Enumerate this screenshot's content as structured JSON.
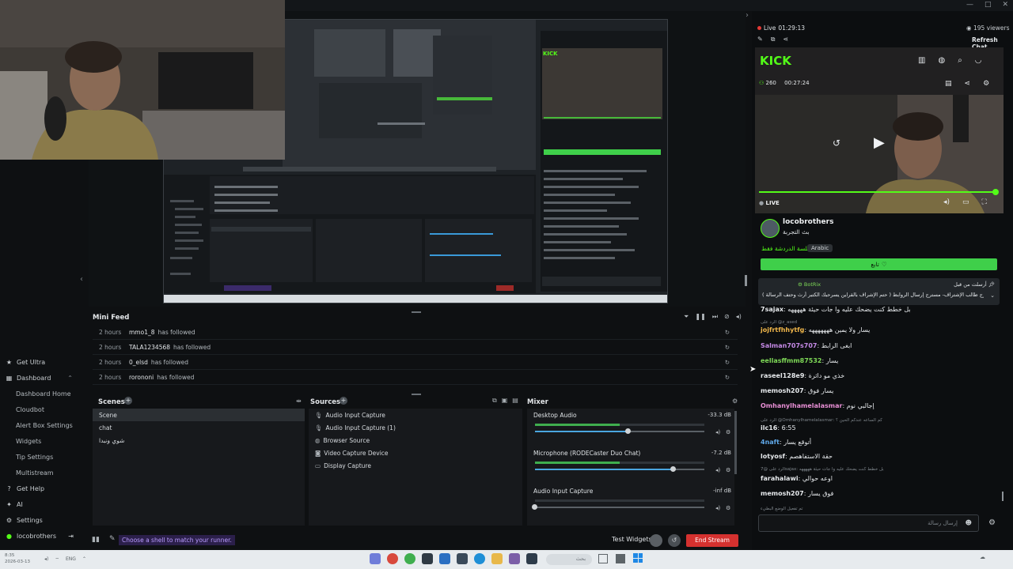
{
  "window": {
    "controls": [
      "—",
      "□",
      "✕"
    ]
  },
  "stream": {
    "live_label": "Live",
    "live_time": "01:29:13",
    "viewers": "195 viewers",
    "refresh_chat": "Refresh Chat"
  },
  "kick": {
    "logo": "KICK",
    "viewer_count": "260",
    "elapsed": "00:27:24",
    "live_badge": "LIVE",
    "channel_name": "locobrothers",
    "channel_subtitle": "بث التجربة",
    "category": "مسلسة الدردشة فقط",
    "language_tag": "Arabic",
    "follow_label": "تابع",
    "pinned_bot": "BotRix",
    "pinned_title": "أرسلت من قبل",
    "pinned_text": "لغيرين- مسترج طالب الإشتراف- مسترج إرسال الروابط ( حتم الإشراف بالقراين يسرحبك الكتبر أرث وحتف الرسالة )",
    "chat_placeholder": "إرسال رسالة"
  },
  "chat": [
    {
      "user": "7sajax",
      "color": "#e6e9ec",
      "text": ": بل خطط كنت يضحك عليه وا جات حيئة هههههه"
    },
    {
      "user": "jojfrtfhhytfg",
      "color": "#f0b64a",
      "text": ": يسار ولا يمين هههههههه"
    },
    {
      "user": "Salman707s707",
      "color": "#c58ae6",
      "text": ": ابغى الرابط"
    },
    {
      "user": "eellasffmm87532",
      "color": "#7ed957",
      "text": ": يسار"
    },
    {
      "user": "raseel128e9",
      "color": "#e6e9ec",
      "text": ": خذي مو داثرة"
    },
    {
      "user": "memosh207",
      "color": "#e6e9ec",
      "text": ": يسار فوق"
    },
    {
      "user": "Omhanylhamelalasmar",
      "color": "#e88fd5",
      "text": ": إجالبي نوم"
    },
    {
      "user": "ilc16",
      "color": "#e6e9ec",
      "text": ": 6:55"
    },
    {
      "user": "4naft",
      "color": "#5fa8e8",
      "text": ": أتوقع يسار"
    },
    {
      "user": "lotyosf",
      "color": "#e6e9ec",
      "text": ": حقة الاستفاهصم"
    },
    {
      "user": "farahalawi",
      "color": "#e6e9ec",
      "text": ": اوعه حوالي"
    },
    {
      "user": "memosh207",
      "color": "#e6e9ec",
      "text": ": فوق يسار"
    }
  ],
  "chat_replies": [
    "الرد على @Omhanylhamelalasmar: كم الساعه عندكم الحين ؟",
    "الرد على @7sajax: بل خطط كنت يضحك عليه وا جات حيئة هههههه",
    "الرد على @z_ased"
  ],
  "chat_typing": "تم تفعيل الوضع البطيء",
  "nav": {
    "items": [
      {
        "label": "Get Ultra",
        "icon": "★",
        "sub": false
      },
      {
        "label": "Dashboard",
        "icon": "▦",
        "sub": false
      },
      {
        "label": "Dashboard Home",
        "sub": true
      },
      {
        "label": "Cloudbot",
        "sub": true
      },
      {
        "label": "Alert Box Settings",
        "sub": true
      },
      {
        "label": "Widgets",
        "sub": true
      },
      {
        "label": "Tip Settings",
        "sub": true
      },
      {
        "label": "Multistream",
        "sub": true
      },
      {
        "label": "Get Help",
        "icon": "?",
        "sub": false
      },
      {
        "label": "AI",
        "icon": "✦",
        "sub": false
      },
      {
        "label": "Settings",
        "icon": "⚙",
        "sub": false
      },
      {
        "label": "locobrothers",
        "icon": "●",
        "sub": false
      }
    ]
  },
  "minifeed": {
    "title": "Mini Feed",
    "rows": [
      {
        "time": "2 hours",
        "user": "mmo1_8",
        "action": "has followed"
      },
      {
        "time": "2 hours",
        "user": "TALA1234568",
        "action": "has followed"
      },
      {
        "time": "2 hours",
        "user": "0_elsd",
        "action": "has followed"
      },
      {
        "time": "2 hours",
        "user": "rorononi",
        "action": "has followed"
      }
    ]
  },
  "scenes": {
    "title": "Scenes",
    "items": [
      "Scene",
      "chat",
      "شوي ونبدا"
    ]
  },
  "sources": {
    "title": "Sources",
    "items": [
      "Audio Input Capture",
      "Audio Input Capture (1)",
      "Browser Source",
      "Video Capture Device",
      "Display Capture"
    ]
  },
  "mixer": {
    "title": "Mixer",
    "channels": [
      {
        "name": "Desktop Audio",
        "db": "-33.3 dB",
        "level": 0.55
      },
      {
        "name": "Microphone (RODECaster Duo Chat)",
        "db": "-7.2 dB",
        "level": 0.82
      },
      {
        "name": "Audio Input Capture",
        "db": "-inf dB",
        "level": 0.0
      }
    ]
  },
  "bottombar": {
    "tip": "Choose a shell to match your runner.",
    "test_widgets": "Test Widgets",
    "end_stream": "End Stream"
  },
  "taskbar": {
    "time": "8:35",
    "date": "2026-03-13",
    "lang": "ENG",
    "search": "بحث"
  },
  "colors": {
    "kick_green": "#53fc18",
    "follow_green": "#3fcf4a",
    "end_stream": "#d5312f"
  }
}
